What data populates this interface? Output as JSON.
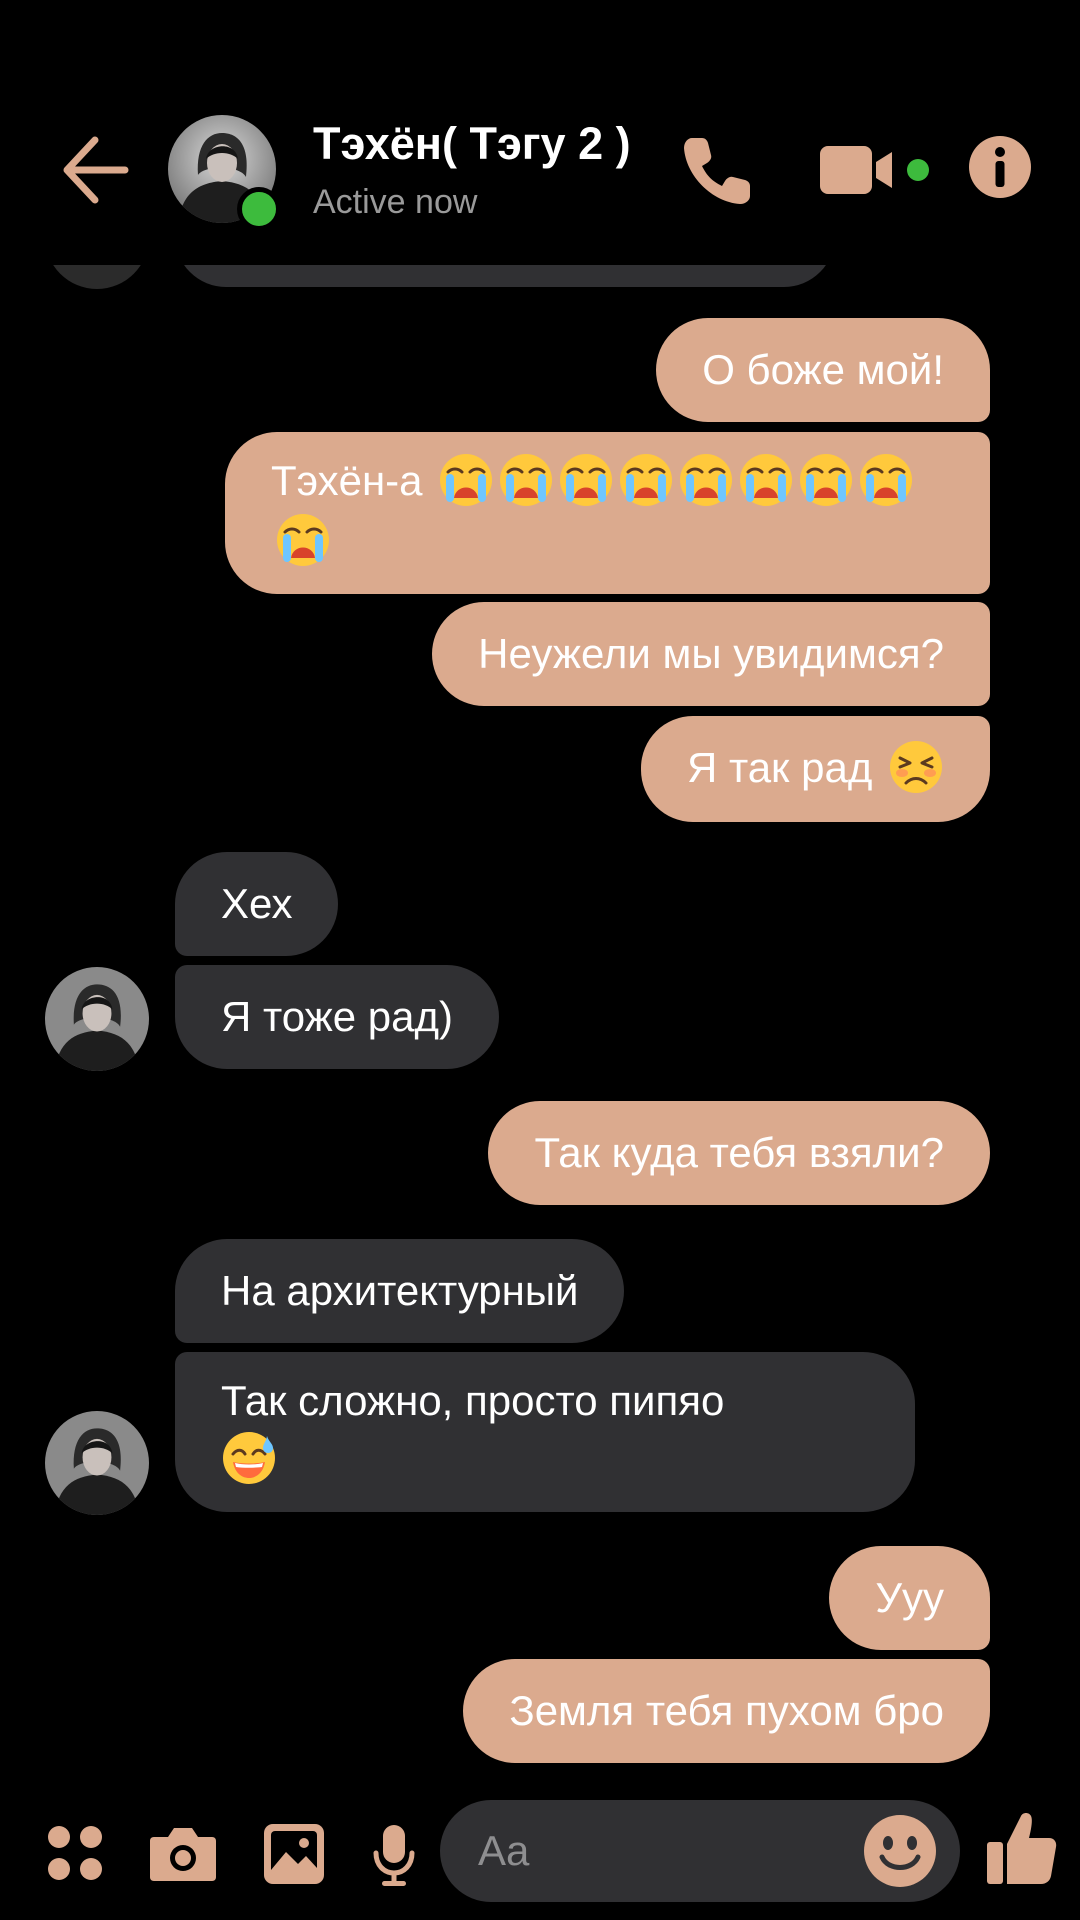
{
  "header": {
    "contact_name": "Тэхён( Тэгу 2 )",
    "status": "Active now"
  },
  "colors": {
    "accent": "#dbaa8e",
    "outgoing_bubble": "#dbaa8e",
    "incoming_bubble": "#303033",
    "online": "#3dbb3d",
    "background": "#000000"
  },
  "messages": [
    {
      "direction": "outgoing",
      "text": "О боже мой!"
    },
    {
      "direction": "outgoing",
      "text": "Тэхён-а",
      "emoji": "loudly-crying-face",
      "emoji_count": 9
    },
    {
      "direction": "outgoing",
      "text": "Неужели мы увидимся?"
    },
    {
      "direction": "outgoing",
      "text": "Я так рад",
      "emoji": "tired-face",
      "emoji_count": 1
    },
    {
      "direction": "incoming",
      "text": "Хех"
    },
    {
      "direction": "incoming",
      "text": "Я тоже рад)"
    },
    {
      "direction": "outgoing",
      "text": "Так куда тебя взяли?"
    },
    {
      "direction": "incoming",
      "text": "На архитектурный"
    },
    {
      "direction": "incoming",
      "text": "Так сложно, просто пипяо",
      "emoji": "sweat-smile-face",
      "emoji_count": 1
    },
    {
      "direction": "outgoing",
      "text": "Ууу"
    },
    {
      "direction": "outgoing",
      "text": "Земля тебя пухом бро"
    }
  ],
  "composer": {
    "placeholder": "Aa",
    "icons": [
      "apps-icon",
      "camera-icon",
      "gallery-icon",
      "microphone-icon",
      "emoji-icon",
      "like-icon"
    ]
  }
}
